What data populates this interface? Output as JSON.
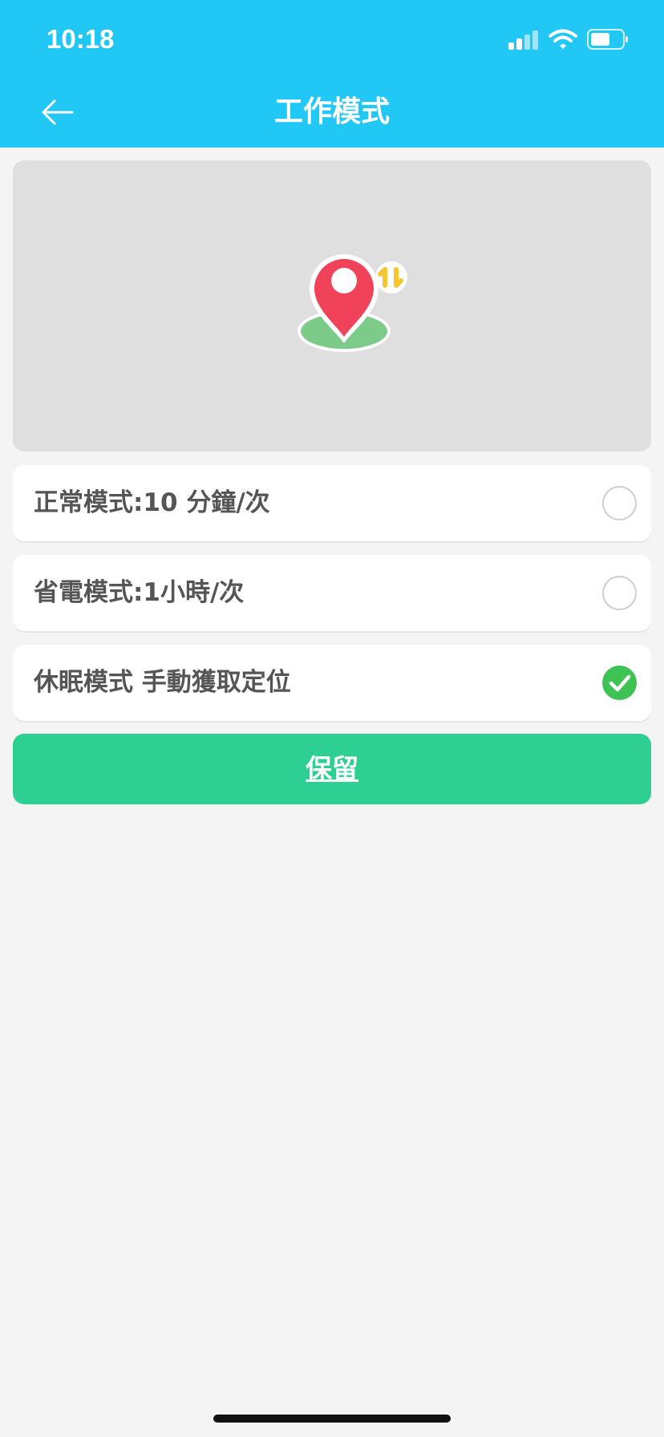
{
  "status_bar": {
    "time": "10:18"
  },
  "header": {
    "title": "工作模式"
  },
  "icons": {
    "back": "arrow-left-icon",
    "hero": "location-pin-sync-icon",
    "selected": "check-circle-icon",
    "unselected": "radio-empty-icon"
  },
  "modes": [
    {
      "label": "正常模式:10 分鐘/次",
      "selected": false
    },
    {
      "label": "省電模式:1小時/次",
      "selected": false
    },
    {
      "label": "休眠模式 手動獲取定位",
      "selected": true
    }
  ],
  "save_button": {
    "label": "保留"
  },
  "colors": {
    "header": "#21c8f6",
    "save": "#2ecf92",
    "selected": "#3ec254",
    "pin": "#f0435a",
    "ground": "#7ccb89",
    "sync": "#f7c531"
  }
}
